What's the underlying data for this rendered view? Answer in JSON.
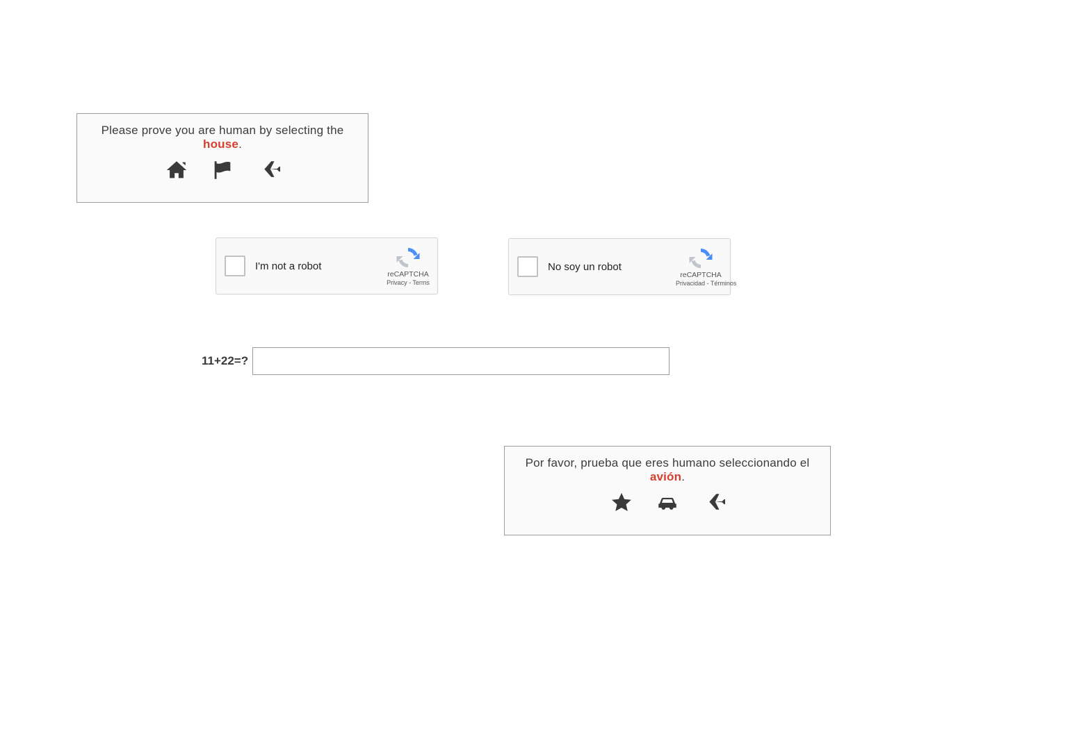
{
  "captcha_en": {
    "prompt_prefix": "Please prove you are human by selecting the ",
    "target_word": "house",
    "prompt_suffix": ".",
    "icons": [
      "house",
      "flag",
      "plane"
    ]
  },
  "captcha_es": {
    "prompt_prefix": "Por favor, prueba que eres humano seleccionando el ",
    "target_word": "avión",
    "prompt_suffix": ".",
    "icons": [
      "star",
      "car",
      "plane"
    ]
  },
  "recaptcha_en": {
    "label": "I'm not a robot",
    "brand": "reCAPTCHA",
    "privacy": "Privacy",
    "sep": " - ",
    "terms": "Terms"
  },
  "recaptcha_es": {
    "label": "No soy un robot",
    "brand": "reCAPTCHA",
    "privacy": "Privacidad",
    "sep": " - ",
    "terms": "Términos"
  },
  "math": {
    "question": "11+22=?",
    "value": ""
  }
}
